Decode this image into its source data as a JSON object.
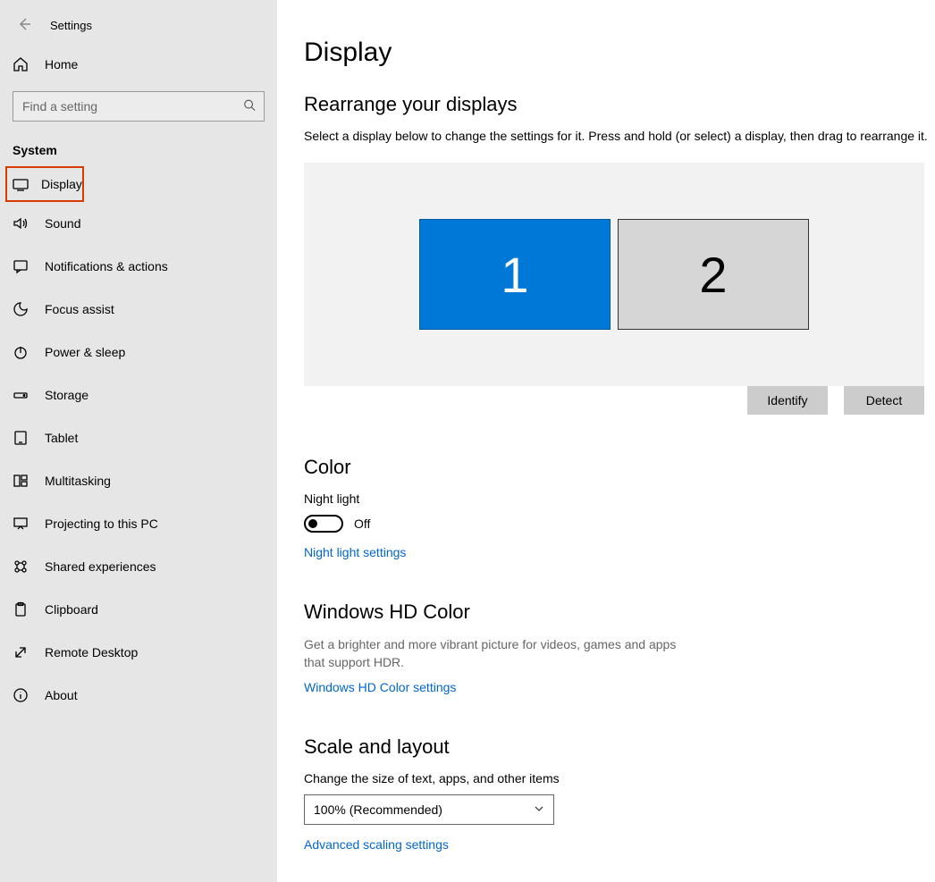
{
  "app_title": "Settings",
  "search_placeholder": "Find a setting",
  "home_label": "Home",
  "category": "System",
  "nav_items": [
    {
      "key": "display",
      "label": "Display",
      "highlight": true
    },
    {
      "key": "sound",
      "label": "Sound"
    },
    {
      "key": "notifications",
      "label": "Notifications & actions"
    },
    {
      "key": "focus",
      "label": "Focus assist"
    },
    {
      "key": "power",
      "label": "Power & sleep"
    },
    {
      "key": "storage",
      "label": "Storage"
    },
    {
      "key": "tablet",
      "label": "Tablet"
    },
    {
      "key": "multitasking",
      "label": "Multitasking"
    },
    {
      "key": "projecting",
      "label": "Projecting to this PC"
    },
    {
      "key": "shared",
      "label": "Shared experiences"
    },
    {
      "key": "clipboard",
      "label": "Clipboard"
    },
    {
      "key": "remote",
      "label": "Remote Desktop"
    },
    {
      "key": "about",
      "label": "About"
    }
  ],
  "page_title": "Display",
  "rearrange_heading": "Rearrange your displays",
  "rearrange_sub": "Select a display below to change the settings for it. Press and hold (or select) a display, then drag to rearrange it.",
  "monitors": [
    {
      "id": "1",
      "primary": true
    },
    {
      "id": "2",
      "primary": false
    }
  ],
  "identify_label": "Identify",
  "detect_label": "Detect",
  "color_heading": "Color",
  "night_light_label": "Night light",
  "night_light_state": "Off",
  "night_light_link": "Night light settings",
  "hd_heading": "Windows HD Color",
  "hd_sub": "Get a brighter and more vibrant picture for videos, games and apps that support HDR.",
  "hd_link": "Windows HD Color settings",
  "scale_heading": "Scale and layout",
  "scale_sub": "Change the size of text, apps, and other items",
  "scale_value": "100% (Recommended)",
  "scale_link": "Advanced scaling settings"
}
